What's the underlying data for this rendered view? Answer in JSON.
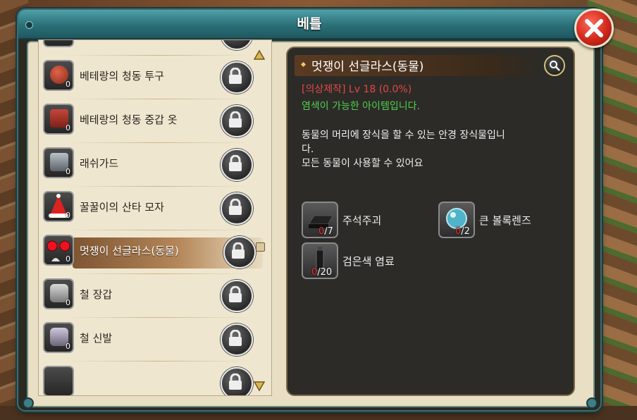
{
  "window": {
    "title": "베틀"
  },
  "recipe_list": {
    "items": [
      {
        "name": "베테랑의 청동 투구",
        "qty": "0",
        "locked": true,
        "icon": "bronze-helmet-icon"
      },
      {
        "name": "베테랑의 청동 중갑 옷",
        "qty": "0",
        "locked": true,
        "icon": "bronze-armor-icon"
      },
      {
        "name": "래쉬가드",
        "qty": "0",
        "locked": true,
        "icon": "rashguard-icon"
      },
      {
        "name": "꿀꿀이의 산타 모자",
        "qty": "0",
        "locked": true,
        "icon": "santa-hat-icon"
      },
      {
        "name": "멋쟁이 선글라스(동물)",
        "qty": "0",
        "locked": true,
        "icon": "sunglasses-icon",
        "selected": true
      },
      {
        "name": "철 장갑",
        "qty": "0",
        "locked": true,
        "icon": "iron-gloves-icon"
      },
      {
        "name": "철 신발",
        "qty": "0",
        "locked": true,
        "icon": "iron-shoes-icon"
      }
    ]
  },
  "detail": {
    "title": "멋쟁이 선글라스(동물)",
    "requirement": "[의상제작] Lv 18 (0.0%)",
    "dye_note": "염색이 가능한 아이템입니다.",
    "description_1": "동물의 머리에 장식을 할 수 있는 안경 장식물입니",
    "description_2": "다.",
    "description_3": "모든 동물이 사용할 수 있어요",
    "materials": [
      {
        "name": "주석주괴",
        "have": "0",
        "need": "/7",
        "icon": "tin-ingot-icon"
      },
      {
        "name": "큰 볼록렌즈",
        "have": "0",
        "need": "/2",
        "icon": "convex-lens-icon"
      },
      {
        "name": "검은색 염료",
        "have": "0",
        "need": "/20",
        "icon": "black-dye-icon"
      }
    ]
  },
  "colors": {
    "title_bar": "#2b6f77",
    "requirement": "#e34848",
    "dye_note": "#4fd04f",
    "selected_row": "#b48658"
  }
}
